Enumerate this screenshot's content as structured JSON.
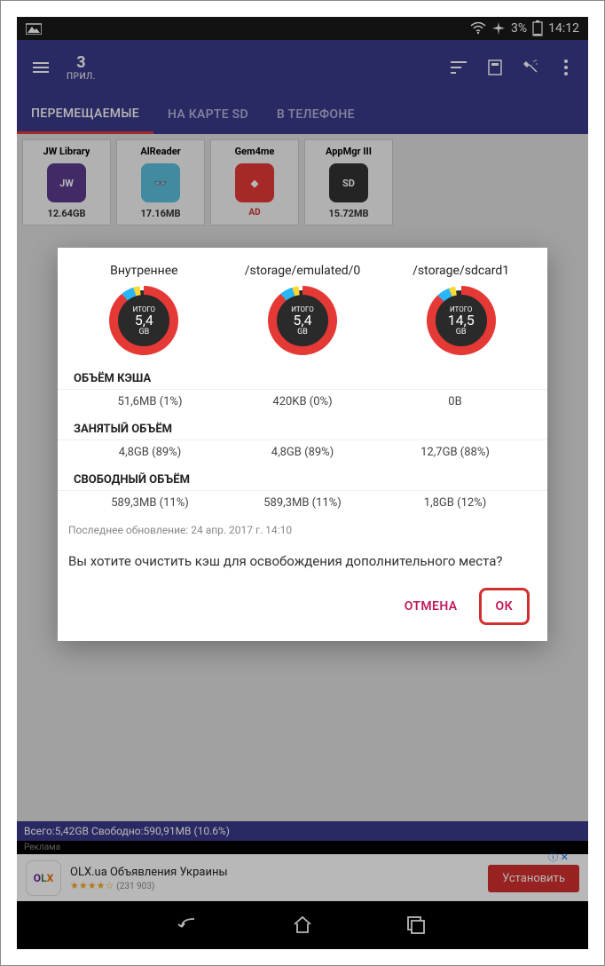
{
  "statusbar": {
    "battery": "3%",
    "time": "14:12"
  },
  "header": {
    "count": "3",
    "sub": "ПРИЛ."
  },
  "tabs": {
    "t1": "ПЕРЕМЕЩАЕМЫЕ",
    "t2": "НА КАРТЕ SD",
    "t3": "В ТЕЛЕФОНЕ"
  },
  "apps": [
    {
      "name": "JW Library",
      "size": "12.64GB",
      "iconText": "JW",
      "iconBg": "#5a3b8e"
    },
    {
      "name": "AlReader",
      "size": "17.16MB",
      "iconText": "👓",
      "iconBg": "#5bc0de"
    },
    {
      "name": "Gem4me",
      "ad": "AD",
      "iconText": "◆",
      "iconBg": "#e53935"
    },
    {
      "name": "AppMgr III",
      "size": "15.72MB",
      "iconText": "SD",
      "iconBg": "#333"
    }
  ],
  "bottomStatus": "Всего:5,42GB Свободно:590,91MB (10.6%)",
  "ad": {
    "label": "Реклама",
    "title": "OLX.ua Объявления Украины",
    "rating": "★★★★☆",
    "count": "(231 903)",
    "btn": "Установить"
  },
  "dialog": {
    "storages": [
      {
        "name": "Внутреннее",
        "total": "ИТОГО",
        "val": "5,4",
        "unit": "GB",
        "pct": 89
      },
      {
        "name": "/storage/emulated/0",
        "total": "ИТОГО",
        "val": "5,4",
        "unit": "GB",
        "pct": 89
      },
      {
        "name": "/storage/sdcard1",
        "total": "ИТОГО",
        "val": "14,5",
        "unit": "GB",
        "pct": 88
      }
    ],
    "sec_cache": "ОБЪЁМ КЭША",
    "cache": [
      "51,6MB (1%)",
      "420KB (0%)",
      "0B"
    ],
    "sec_used": "ЗАНЯТЫЙ ОБЪЁМ",
    "used": [
      "4,8GB (89%)",
      "4,8GB (89%)",
      "12,7GB (88%)"
    ],
    "sec_free": "СВОБОДНЫЙ ОБЪЁМ",
    "free": [
      "589,3MB (11%)",
      "589,3MB (11%)",
      "1,8GB (12%)"
    ],
    "lastUpdate": "Последнее обновление: 24 апр. 2017 г. 14:10",
    "question": "Вы хотите очистить кэш для освобождения дополнительного места?",
    "cancel": "ОТМЕНА",
    "ok": "ОК"
  }
}
